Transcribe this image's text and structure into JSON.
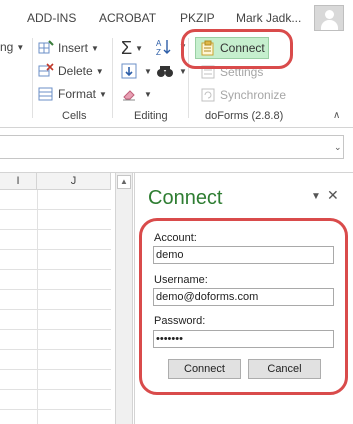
{
  "topbar": {
    "tabs": [
      "ADD-INS",
      "ACROBAT",
      "PKZIP"
    ],
    "user_name": "Mark Jadk..."
  },
  "ribbon": {
    "cells_group": {
      "insert": "Insert",
      "delete": "Delete",
      "format": "Format",
      "label": "Cells",
      "cut_label": "ng"
    },
    "editing_group": {
      "label": "Editing"
    },
    "doforms_group": {
      "connect": "Connect",
      "settings": "Settings",
      "synchronize": "Synchronize",
      "label": "doForms (2.8.8)"
    },
    "colors": {
      "connect_bg": "#c6efce",
      "highlight": "#d94b4b",
      "pane_title": "#2e7d32"
    }
  },
  "grid": {
    "columns": [
      "I",
      "J"
    ]
  },
  "pane": {
    "title": "Connect",
    "fields": [
      {
        "label": "Account:",
        "value": "demo"
      },
      {
        "label": "Username:",
        "value": "demo@doforms.com"
      },
      {
        "label": "Password:",
        "value": "•••••••"
      }
    ],
    "connect_button": "Connect",
    "cancel_button": "Cancel"
  },
  "icons": [
    "user-avatar-icon",
    "insert-cells-icon",
    "delete-cells-icon",
    "format-cells-icon",
    "autosum-icon",
    "fill-icon",
    "clear-icon",
    "sort-filter-icon",
    "find-select-icon",
    "doforms-connect-icon",
    "settings-icon",
    "synchronize-icon"
  ]
}
